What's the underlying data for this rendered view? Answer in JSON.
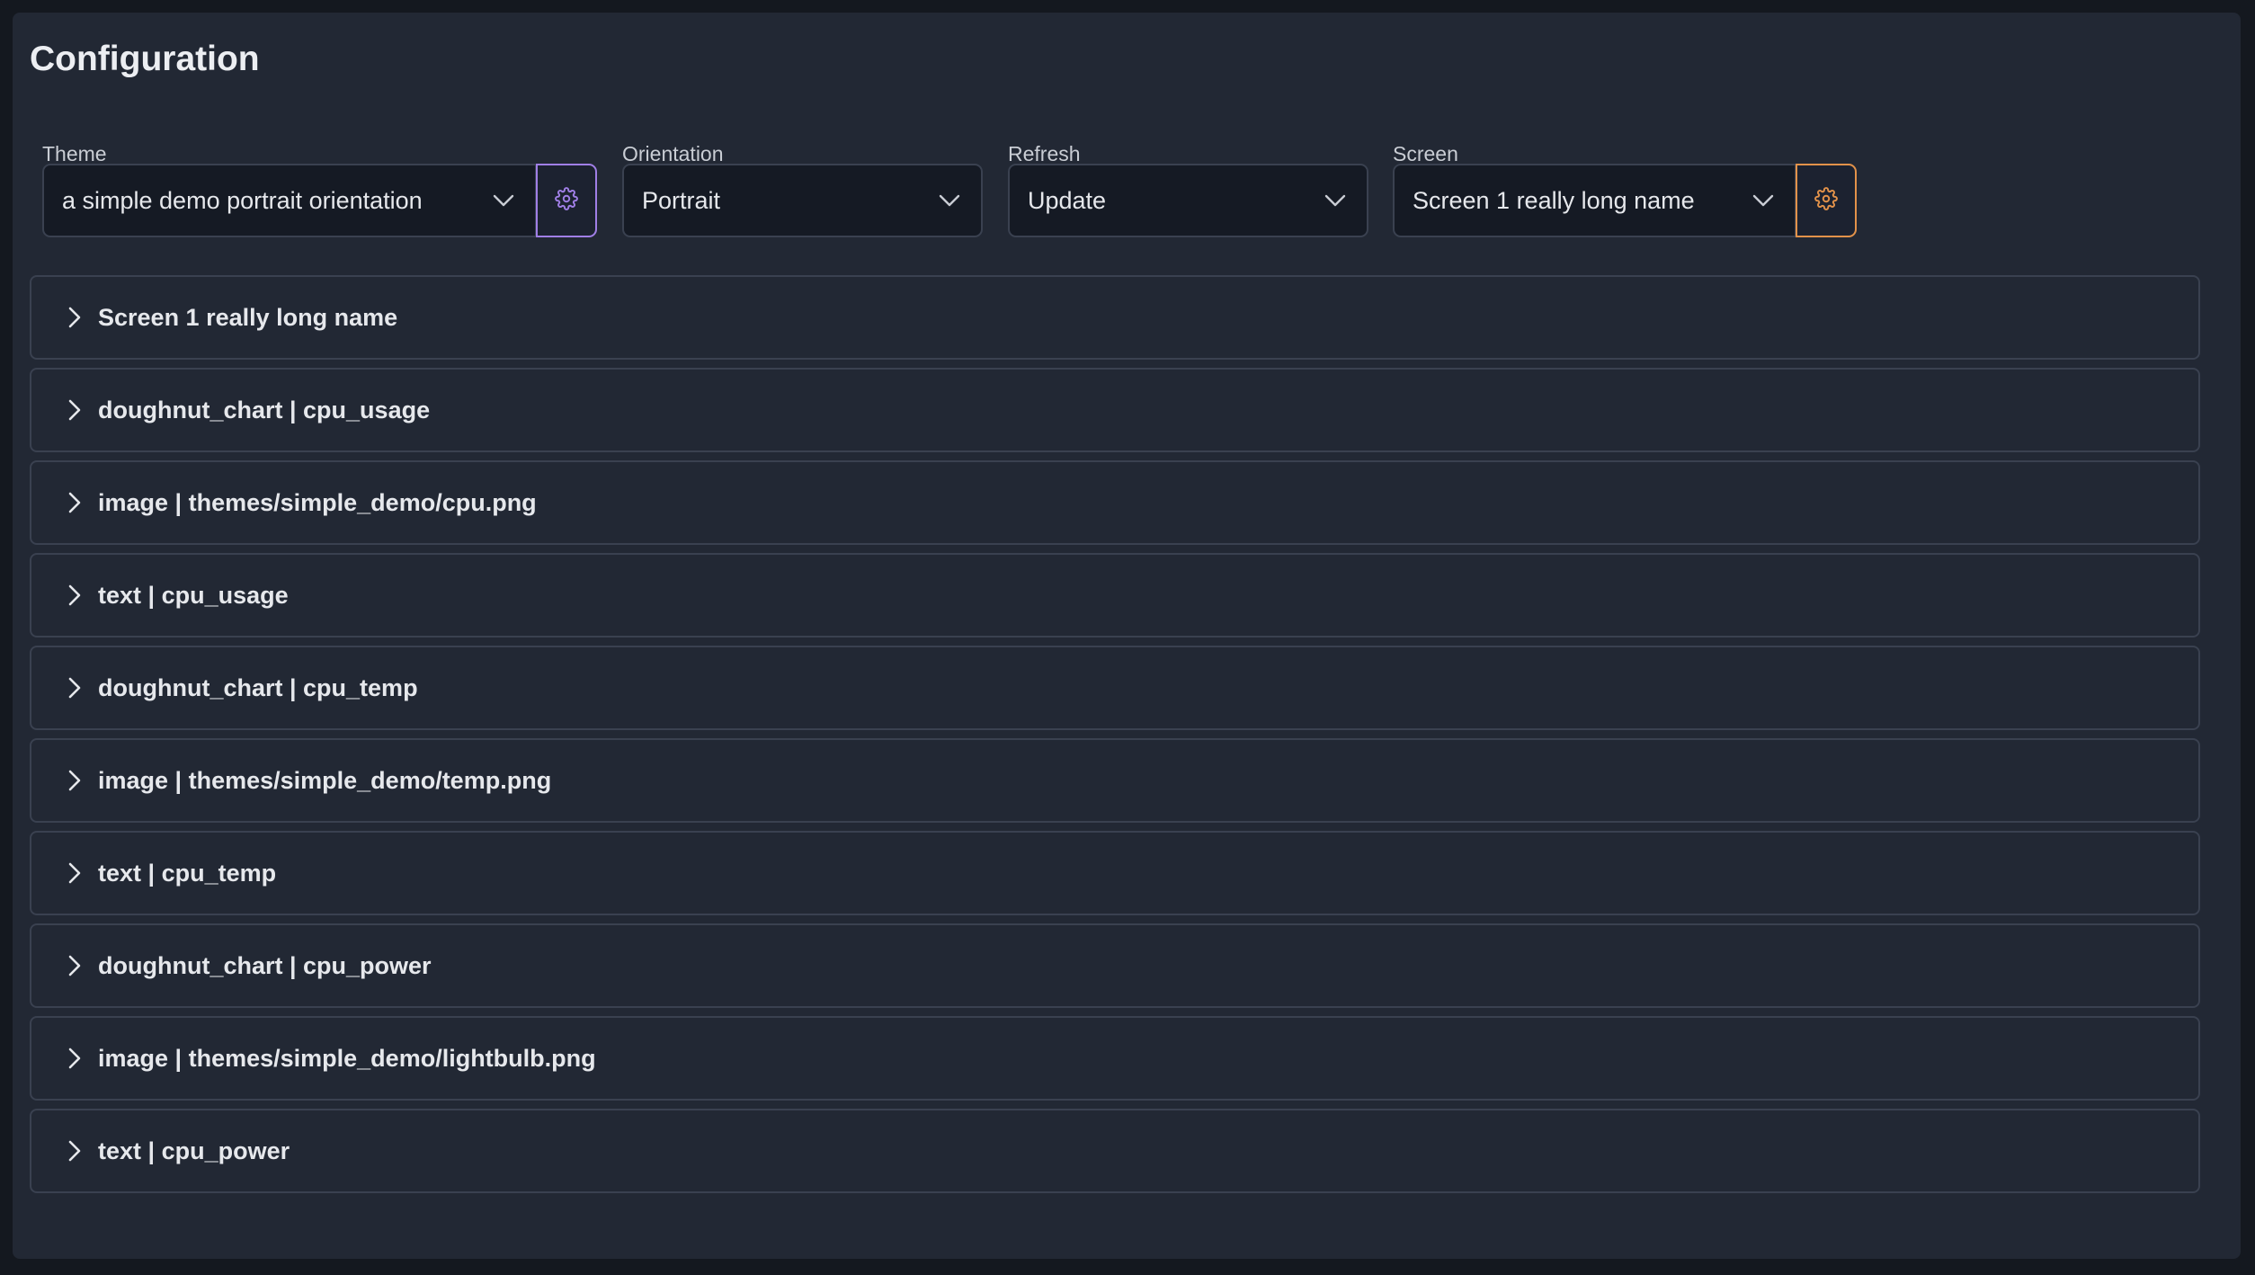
{
  "page": {
    "title": "Configuration"
  },
  "fields": {
    "theme": {
      "label": "Theme",
      "value": "a simple demo portrait orientation"
    },
    "orientation": {
      "label": "Orientation",
      "value": "Portrait"
    },
    "refresh": {
      "label": "Refresh",
      "value": "Update"
    },
    "screen": {
      "label": "Screen",
      "value": "Screen 1 really long name"
    }
  },
  "colors": {
    "theme_settings_accent": "#a07fe6",
    "screen_settings_accent": "#e2924a"
  },
  "icons": {
    "select_chevron": "chevron-down-icon",
    "settings": "gear-icon",
    "expand": "chevron-right-icon"
  },
  "accordion": [
    "Screen 1 really long name",
    "doughnut_chart | cpu_usage",
    "image | themes/simple_demo/cpu.png",
    "text | cpu_usage",
    "doughnut_chart | cpu_temp",
    "image | themes/simple_demo/temp.png",
    "text | cpu_temp",
    "doughnut_chart | cpu_power",
    "image | themes/simple_demo/lightbulb.png",
    "text | cpu_power"
  ]
}
